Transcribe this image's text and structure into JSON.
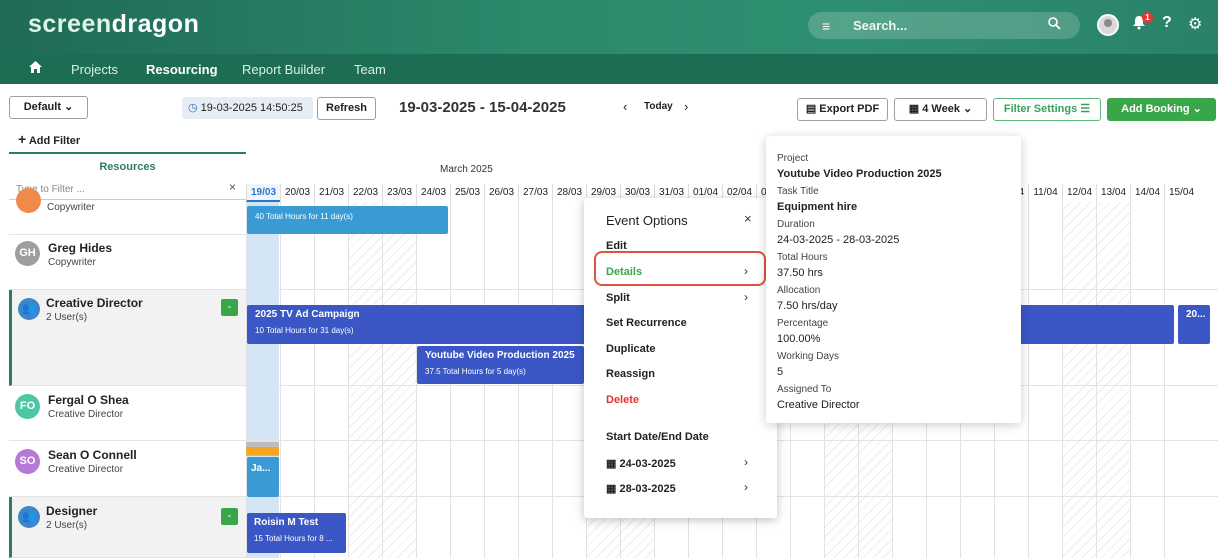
{
  "header": {
    "logo_part1": "screen",
    "logo_part2": "dragon",
    "search_placeholder": "Search...",
    "notification_count": "1",
    "help": "?"
  },
  "nav": {
    "items": [
      "Projects",
      "Resourcing",
      "Report Builder",
      "Team"
    ],
    "active": "Resourcing"
  },
  "toolbar": {
    "view": "Default",
    "timestamp": "19-03-2025 14:50:25",
    "refresh": "Refresh",
    "date_range": "19-03-2025 - 15-04-2025",
    "today": "Today",
    "export_pdf": "Export PDF",
    "period": "4 Week",
    "filter_settings": "Filter Settings",
    "add_booking": "Add Booking",
    "add_filter": "Add Filter"
  },
  "resources": {
    "title": "Resources",
    "filter_placeholder": "Type to Filter ...",
    "rows": [
      {
        "role": "Copywriter"
      },
      {
        "name": "Greg Hides",
        "role": "Copywriter",
        "initials": "GH",
        "color": "#9e9e9e"
      },
      {
        "name": "Creative Director",
        "role": "2 User(s)"
      },
      {
        "name": "Fergal O Shea",
        "role": "Creative Director",
        "initials": "FO",
        "color": "#4dc6a3"
      },
      {
        "name": "Sean O Connell",
        "role": "Creative Director",
        "initials": "SO",
        "color": "#b57ad6"
      },
      {
        "name": "Designer",
        "role": "2 User(s)"
      }
    ],
    "collapse": "-"
  },
  "calendar": {
    "month": "March 2025",
    "days": [
      "19/03",
      "20/03",
      "21/03",
      "22/03",
      "23/03",
      "24/03",
      "25/03",
      "26/03",
      "27/03",
      "28/03",
      "29/03",
      "30/03",
      "31/03",
      "01/04",
      "02/04",
      "03/04",
      "04/04",
      "05/04",
      "06/04",
      "07/04",
      "08/04",
      "09/04",
      "10/04",
      "11/04",
      "12/04",
      "13/04",
      "14/04",
      "15/04"
    ],
    "bars": [
      {
        "sub": "40 Total Hours for 11 day(s)"
      },
      {
        "title": "2025 TV Ad Campaign",
        "sub": "10 Total Hours for 31 day(s)"
      },
      {
        "title": "20..."
      },
      {
        "title": "Youtube Video Production 2025",
        "sub": "37.5 Total Hours for 5 day(s)"
      },
      {
        "title": "Ja..."
      },
      {
        "title": "Roisin M Test",
        "sub": "15 Total Hours for 8 ..."
      }
    ],
    "colors": {
      "bar_blue": "#3b57c6",
      "bar_light": "#3a9bd4",
      "accent_orange": "#f5a623"
    }
  },
  "event_menu": {
    "title": "Event Options",
    "close": "×",
    "items": [
      "Edit",
      "Details",
      "Split",
      "Set Recurrence",
      "Duplicate",
      "Reassign",
      "Delete"
    ],
    "dates_label": "Start Date/End Date",
    "start": "24-03-2025",
    "end": "28-03-2025"
  },
  "details": {
    "project_label": "Project",
    "project": "Youtube Video Production 2025",
    "task_label": "Task Title",
    "task": "Equipment hire",
    "duration_label": "Duration",
    "duration": "24-03-2025 - 28-03-2025",
    "hours_label": "Total Hours",
    "hours": "37.50 hrs",
    "allocation_label": "Allocation",
    "allocation": "7.50 hrs/day",
    "percentage_label": "Percentage",
    "percentage": "100.00%",
    "working_days_label": "Working Days",
    "working_days": "5",
    "assigned_label": "Assigned To",
    "assigned": "Creative Director"
  }
}
